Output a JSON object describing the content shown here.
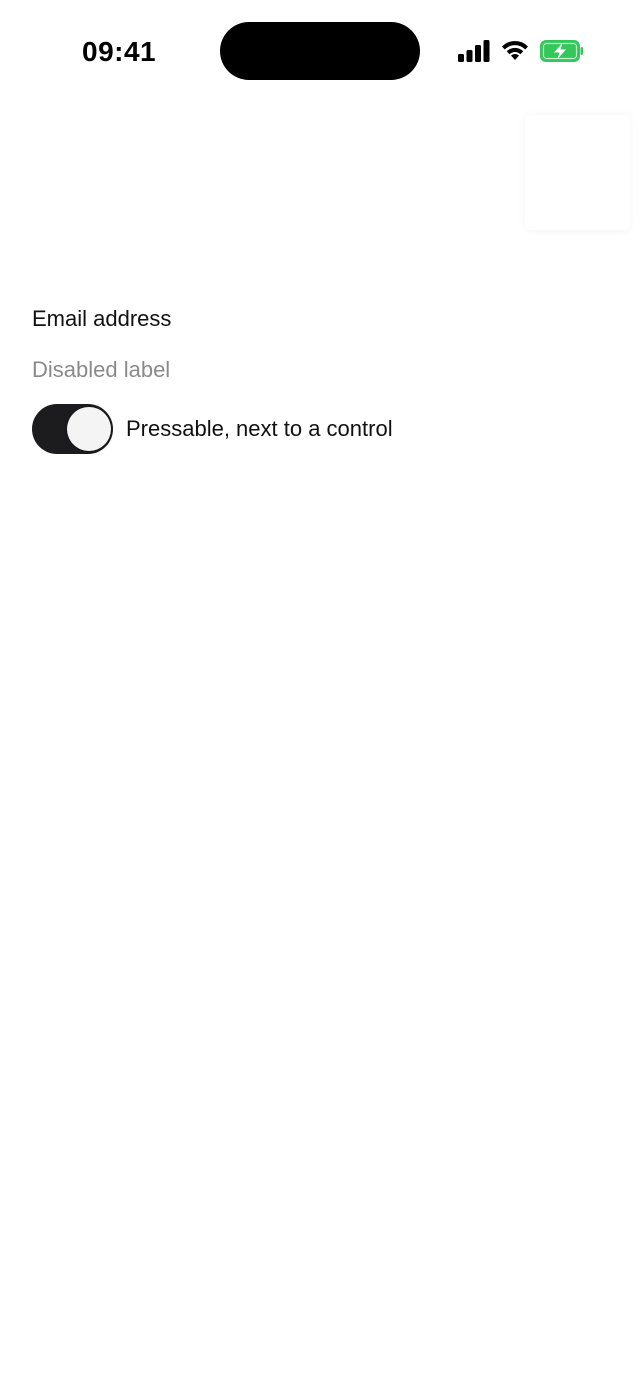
{
  "status_bar": {
    "time": "09:41",
    "icons": [
      "signal-icon",
      "wifi-icon",
      "battery-charging-icon"
    ],
    "battery_color": "#34c759"
  },
  "labels": {
    "email": "Email address",
    "disabled": "Disabled label"
  },
  "toggle_row": {
    "label": "Pressable, next to a control",
    "switch_on": true,
    "track_color": "#1c1c1e"
  }
}
